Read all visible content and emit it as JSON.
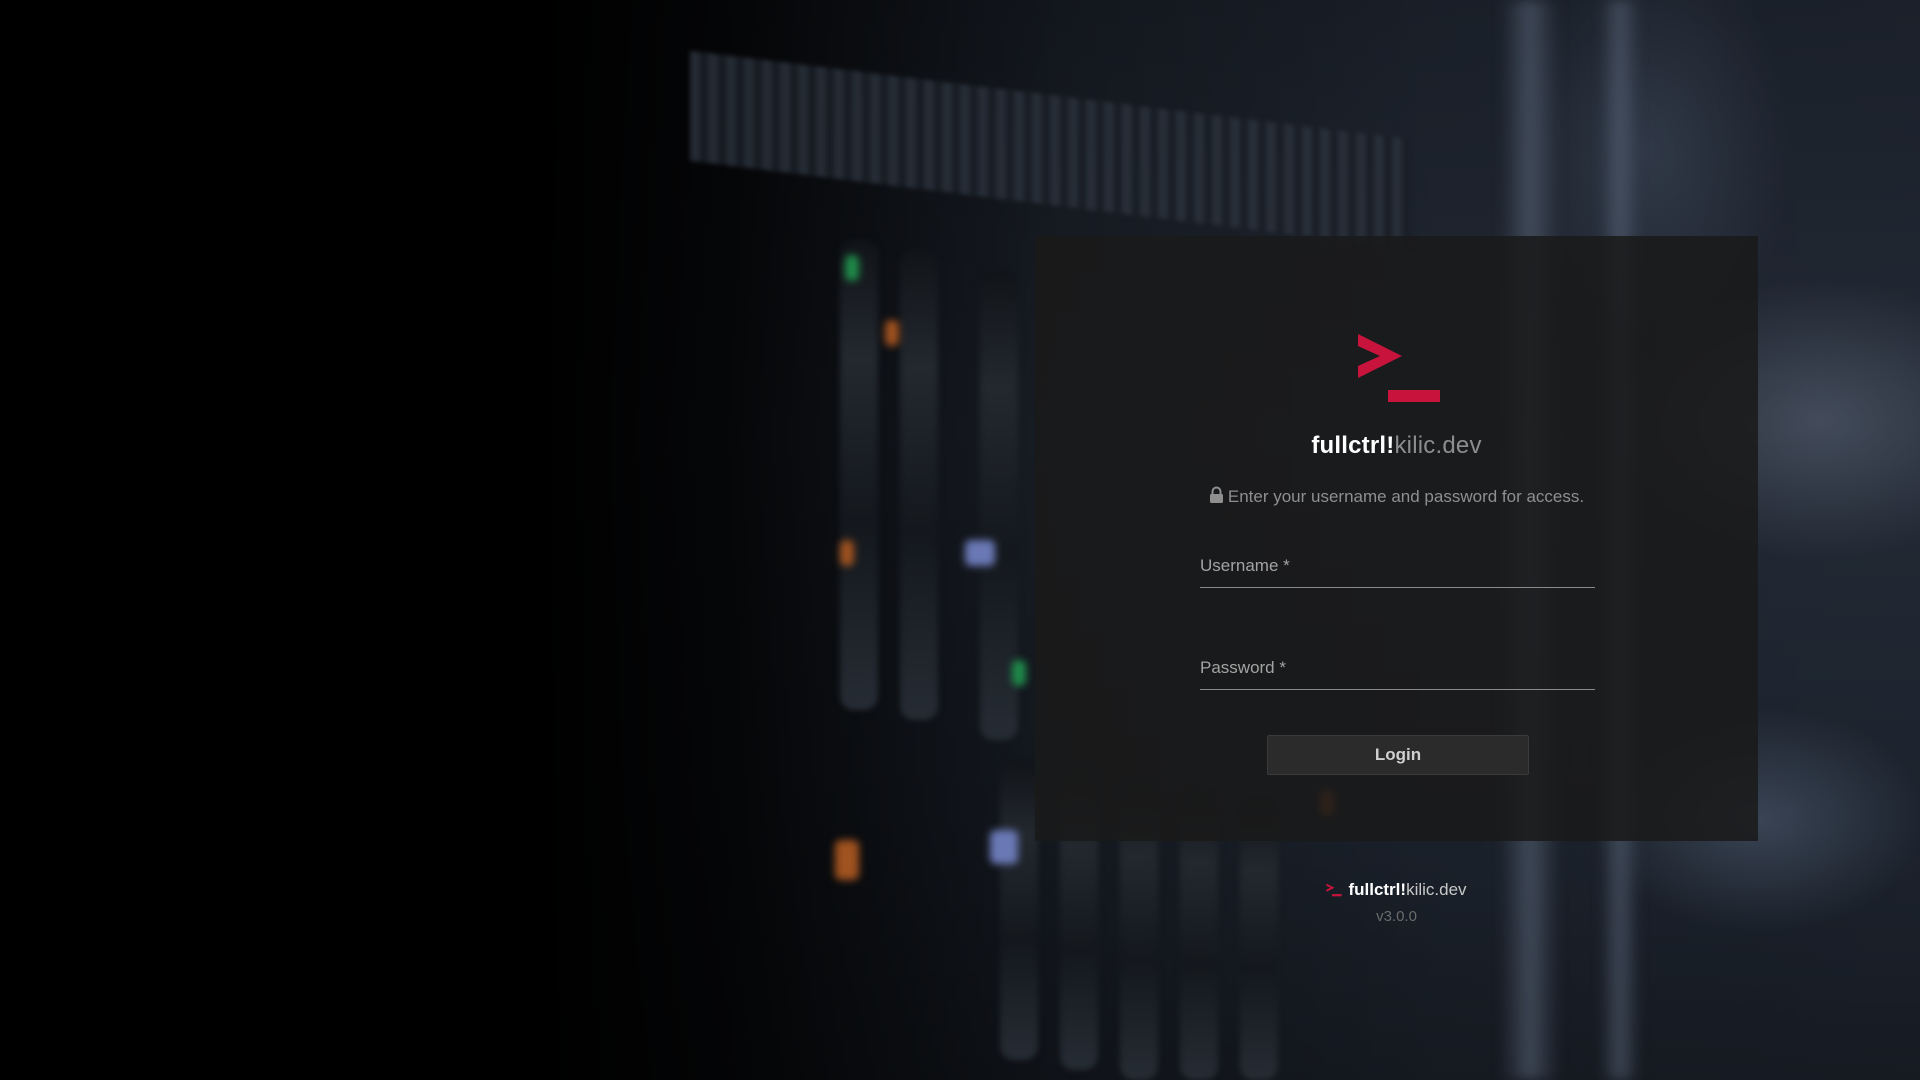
{
  "brand": {
    "name_bold": "fullctrl!",
    "name_light": "kilic.dev",
    "logo_icon": "terminal-prompt-icon",
    "accent_color": "#c8143c"
  },
  "login": {
    "hint_icon": "lock-icon",
    "hint": "Enter your username and password for access.",
    "username_label": "Username *",
    "username_value": "",
    "password_label": "Password *",
    "password_value": "",
    "button_label": "Login"
  },
  "footer": {
    "name_bold": "fullctrl!",
    "name_light": "kilic.dev",
    "version": "v3.0.0"
  }
}
